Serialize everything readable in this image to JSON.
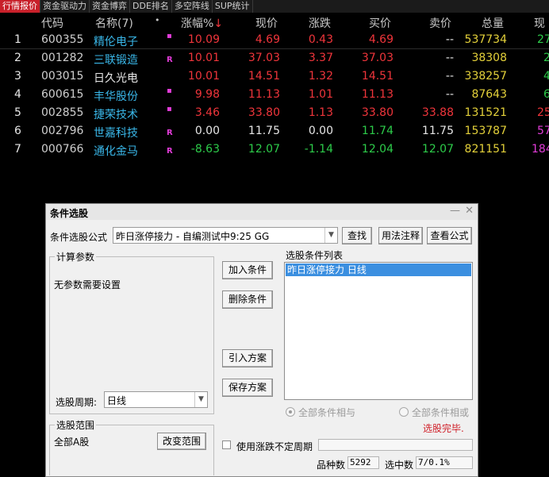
{
  "tabs": [
    "行情报价",
    "资金驱动力",
    "资金博弈",
    "DDE排名",
    "多空阵线",
    "SUP统计"
  ],
  "columns": {
    "code": "代码",
    "name": "名称(7)",
    "dot": "•",
    "pct": "涨幅%",
    "sort_arrow": "↓",
    "price": "现价",
    "change": "涨跌",
    "bid": "买价",
    "ask": "卖价",
    "volume": "总量",
    "now": "现"
  },
  "rows": [
    {
      "idx": "1",
      "code": "600355",
      "name": "精伦电子",
      "badge": "",
      "pct": "10.09",
      "price": "4.69",
      "change": "0.43",
      "bid": "4.69",
      "ask": "--",
      "volume": "537734",
      "extra": "27"
    },
    {
      "idx": "2",
      "code": "001282",
      "name": "三联锻造",
      "badge": "R",
      "pct": "10.01",
      "price": "37.03",
      "change": "3.37",
      "bid": "37.03",
      "ask": "--",
      "volume": "38308",
      "extra": "2"
    },
    {
      "idx": "3",
      "code": "003015",
      "name": "日久光电",
      "badge": "",
      "pct": "10.01",
      "price": "14.51",
      "change": "1.32",
      "bid": "14.51",
      "ask": "--",
      "volume": "338257",
      "extra": "4"
    },
    {
      "idx": "4",
      "code": "600615",
      "name": "丰华股份",
      "badge": "",
      "pct": "9.98",
      "price": "11.13",
      "change": "1.01",
      "bid": "11.13",
      "ask": "--",
      "volume": "87643",
      "extra": "6"
    },
    {
      "idx": "5",
      "code": "002855",
      "name": "捷荣技术",
      "badge": "",
      "pct": "3.46",
      "price": "33.80",
      "change": "1.13",
      "bid": "33.80",
      "ask": "33.88",
      "volume": "131521",
      "extra": "25"
    },
    {
      "idx": "6",
      "code": "002796",
      "name": "世嘉科技",
      "badge": "R",
      "pct": "0.00",
      "price": "11.75",
      "change": "0.00",
      "bid": "11.74",
      "ask": "11.75",
      "volume": "153787",
      "extra": "57"
    },
    {
      "idx": "7",
      "code": "000766",
      "name": "通化金马",
      "badge": "R",
      "pct": "-8.63",
      "price": "12.07",
      "change": "-1.14",
      "bid": "12.04",
      "ask": "12.07",
      "volume": "821151",
      "extra": "184"
    }
  ],
  "dialog": {
    "title": "条件选股",
    "formula_label": "条件选股公式",
    "formula_value": "昨日涨停接力 - 自编测试中9:25 GG",
    "btn_find": "查找",
    "btn_usage": "用法注释",
    "btn_view": "查看公式",
    "params_group": "计算参数",
    "params_text": "无参数需要设置",
    "period_label": "选股周期:",
    "period_value": "日线",
    "btn_add": "加入条件",
    "btn_delete": "删除条件",
    "btn_import": "引入方案",
    "btn_save": "保存方案",
    "cond_list_label": "选股条件列表",
    "cond_item": "昨日涨停接力  日线",
    "radio_and": "全部条件相与",
    "radio_or": "全部条件相或",
    "done_text": "选股完毕.",
    "range_group": "选股范围",
    "range_value": "全部A股",
    "btn_change_range": "改变范围",
    "checkbox_label": "使用涨跌不定周期",
    "count_label": "品种数",
    "count_value": "5292",
    "selected_label": "选中数",
    "selected_value": "7/0.1%"
  },
  "colors": {
    "up": "#f0353b",
    "down": "#2dcc4a",
    "name": "#3ab8ea",
    "volume": "#e4d13a",
    "active_tab": "#c8202a"
  }
}
